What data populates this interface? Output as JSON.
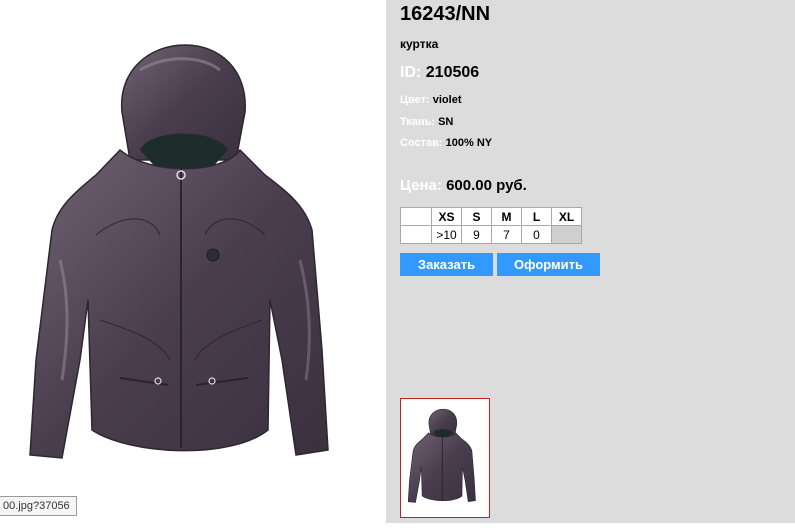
{
  "product": {
    "sku": "16243/NN",
    "subtitle": "куртка",
    "id_label": "ID:",
    "id_value": "210506",
    "color_label": "Цвет:",
    "color_value": "violet",
    "fabric_label": "Ткань:",
    "fabric_value": "SN",
    "composition_label": "Состав:",
    "composition_value": "100% NY",
    "price_label": "Цена:",
    "price_value": "600.00 руб."
  },
  "sizes": {
    "headers": [
      "XS",
      "S",
      "M",
      "L",
      "XL"
    ],
    "stock": [
      ">10",
      "9",
      "7",
      "0",
      ""
    ]
  },
  "buttons": {
    "order": "Заказать",
    "checkout": "Оформить"
  },
  "status_bar": {
    "url_fragment": "00.jpg?37056"
  },
  "colors": {
    "panel_bg": "#dcdcdc",
    "button_bg": "#3399ff",
    "label_text": "#ffffff",
    "thumb_border": "#c02222",
    "jacket": "#4e4252"
  },
  "images": {
    "main": "purple-hooded-puffer-jacket",
    "thumbnail": "purple-hooded-puffer-jacket-thumbnail"
  }
}
